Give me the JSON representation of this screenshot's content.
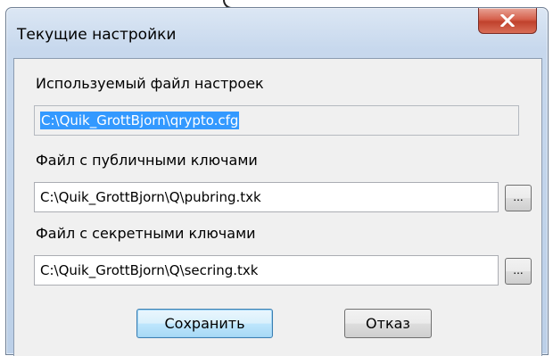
{
  "window": {
    "title": "Текущие настройки",
    "close_label": "x"
  },
  "settings_file": {
    "label": "Используемый файл настроек",
    "value": "C:\\Quik_GrottBjorn\\qrypto.cfg"
  },
  "public_keys": {
    "label": "Файл с публичными ключами",
    "value": "C:\\Quik_GrottBjorn\\Q\\pubring.txk",
    "browse_label": "..."
  },
  "secret_keys": {
    "label": "Файл с секретными ключами",
    "value": "C:\\Quik_GrottBjorn\\Q\\secring.txk",
    "browse_label": "..."
  },
  "buttons": {
    "save": "Сохранить",
    "cancel": "Отказ"
  },
  "colors": {
    "title_bar": "#c7d8ed",
    "client_bg": "#f0f0f0",
    "close_button": "#c0412c",
    "selection": "#3399ff"
  }
}
